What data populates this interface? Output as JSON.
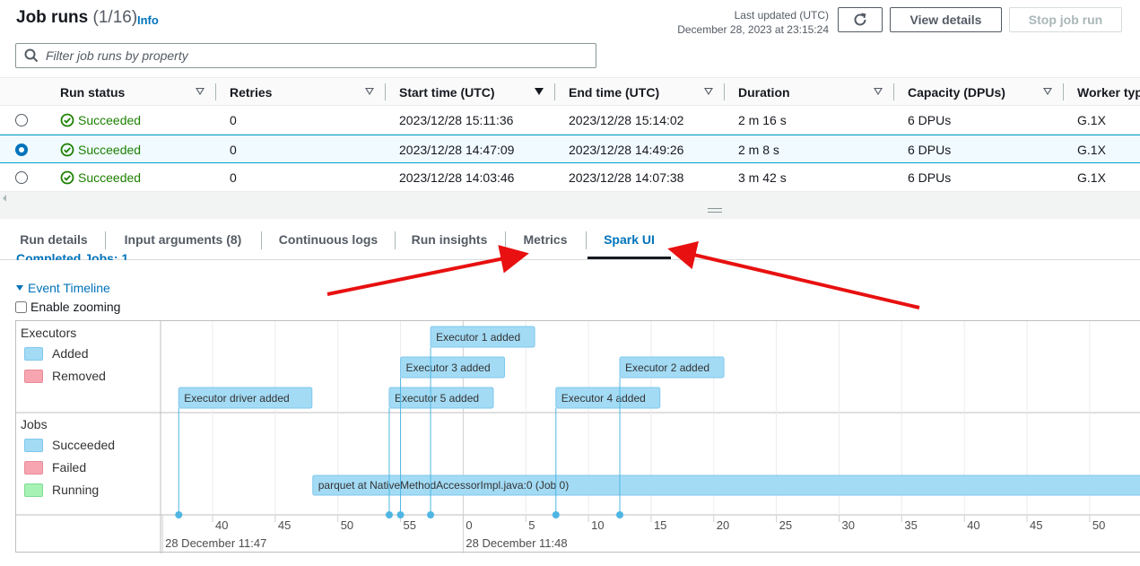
{
  "header": {
    "title": "Job runs",
    "count": "(1/16)",
    "info": "Info",
    "last_updated_label": "Last updated (UTC)",
    "last_updated_value": "December 28, 2023 at 23:15:24",
    "view_details": "View details",
    "stop_job_run": "Stop job run",
    "filter_placeholder": "Filter job runs by property"
  },
  "table": {
    "columns": [
      "Run status",
      "Retries",
      "Start time (UTC)",
      "End time (UTC)",
      "Duration",
      "Capacity (DPUs)",
      "Worker typ"
    ],
    "rows": [
      {
        "status": "Succeeded",
        "retries": "0",
        "start": "2023/12/28 15:11:36",
        "end": "2023/12/28 15:14:02",
        "duration": "2 m 16 s",
        "capacity": "6 DPUs",
        "worker": "G.1X",
        "selected": false
      },
      {
        "status": "Succeeded",
        "retries": "0",
        "start": "2023/12/28 14:47:09",
        "end": "2023/12/28 14:49:26",
        "duration": "2 m 8 s",
        "capacity": "6 DPUs",
        "worker": "G.1X",
        "selected": true
      },
      {
        "status": "Succeeded",
        "retries": "0",
        "start": "2023/12/28 14:03:46",
        "end": "2023/12/28 14:07:38",
        "duration": "3 m 42 s",
        "capacity": "6 DPUs",
        "worker": "G.1X",
        "selected": false
      }
    ]
  },
  "tabs": [
    "Run details",
    "Input arguments (8)",
    "Continuous logs",
    "Run insights",
    "Metrics",
    "Spark UI"
  ],
  "active_tab": "Spark UI",
  "spark": {
    "clipped_heading": "Completed Jobs: 1",
    "event_timeline": "Event Timeline",
    "enable_zooming": "Enable zooming",
    "executors_label": "Executors",
    "executors_legend": [
      "Added",
      "Removed"
    ],
    "jobs_label": "Jobs",
    "jobs_legend": [
      "Succeeded",
      "Failed",
      "Running"
    ],
    "events": [
      {
        "label": "Executor driver added",
        "time": 37.3,
        "level": 3
      },
      {
        "label": "Executor 5 added",
        "time": 54.1,
        "level": 3
      },
      {
        "label": "Executor 3 added",
        "time": 55.0,
        "level": 2
      },
      {
        "label": "Executor 1 added",
        "time": 57.4,
        "level": 1
      },
      {
        "label": "Executor 4 added",
        "time": 67.4,
        "level": 3
      },
      {
        "label": "Executor 2 added",
        "time": 72.5,
        "level": 2
      }
    ],
    "job": {
      "label": "parquet at NativeMethodAccessorImpl.java:0 (Job 0)",
      "start": 48.0
    },
    "axis_ticks": [
      "40",
      "45",
      "50",
      "55",
      "0",
      "5",
      "10",
      "15",
      "20",
      "25",
      "30",
      "35",
      "40",
      "45",
      "50"
    ],
    "axis_tick_values": [
      40,
      45,
      50,
      55,
      60,
      65,
      70,
      75,
      80,
      85,
      90,
      95,
      100,
      105,
      110
    ],
    "axis_dates": [
      {
        "label": "28 December 11:47",
        "at": 36
      },
      {
        "label": "28 December 11:48",
        "at": 60
      }
    ]
  },
  "colors": {
    "accent": "#0073bb",
    "success": "#1d8102",
    "added": "#a3dbf5",
    "removed": "#f7a5b0",
    "running": "#a6f2b5",
    "annotation_arrow": "#e81010"
  }
}
